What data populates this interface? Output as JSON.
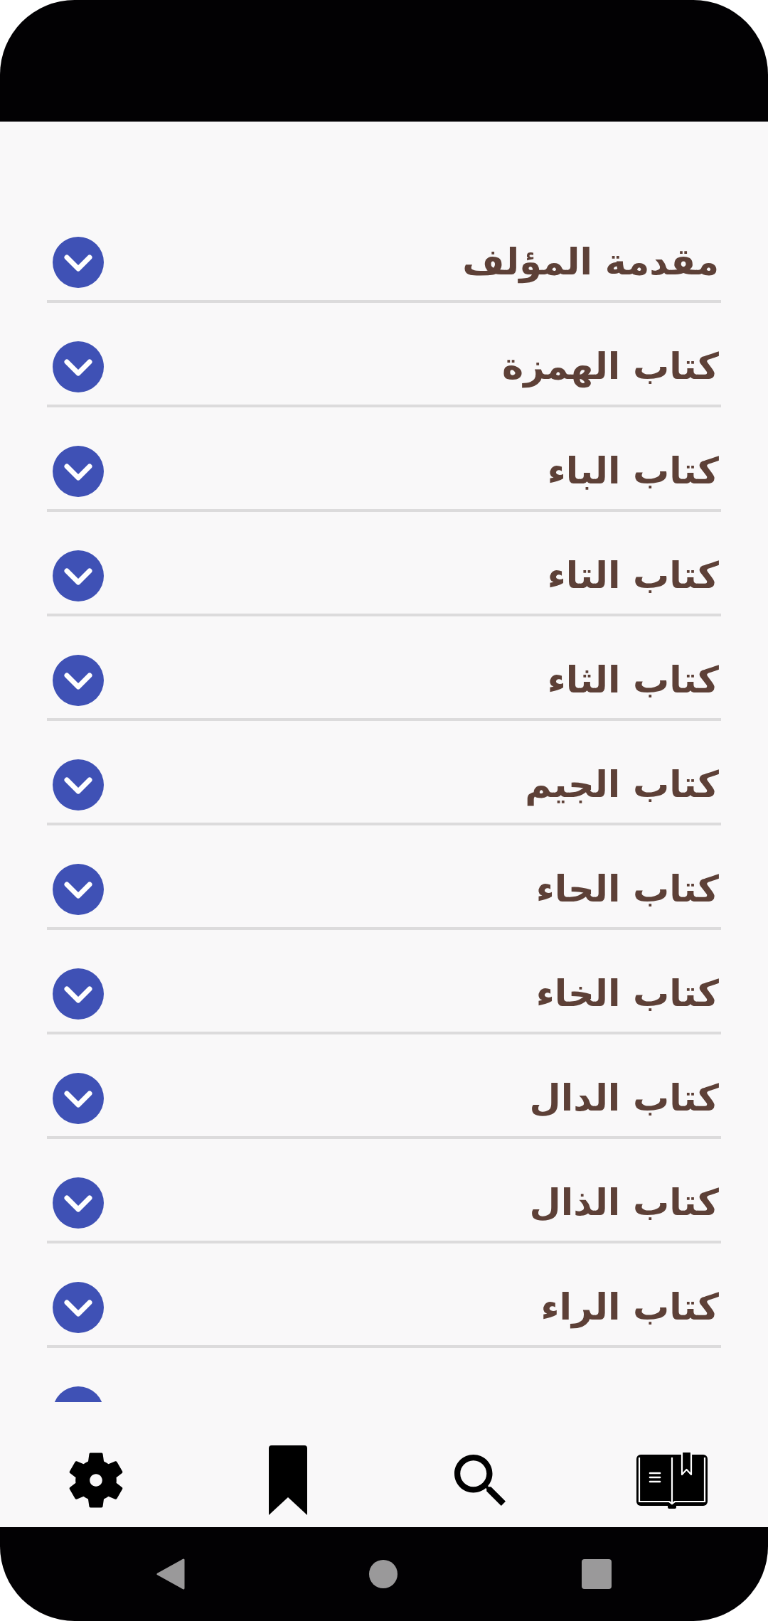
{
  "chapters": [
    {
      "title": "مقدمة المؤلف",
      "expanded": false
    },
    {
      "title": "كتاب الهمزة",
      "expanded": false
    },
    {
      "title": "كتاب الباء",
      "expanded": false
    },
    {
      "title": "كتاب التاء",
      "expanded": false
    },
    {
      "title": "كتاب الثاء",
      "expanded": false
    },
    {
      "title": "كتاب الجيم",
      "expanded": false
    },
    {
      "title": "كتاب الحاء",
      "expanded": false
    },
    {
      "title": "كتاب الخاء",
      "expanded": false
    },
    {
      "title": "كتاب الدال",
      "expanded": false
    },
    {
      "title": "كتاب الذال",
      "expanded": false
    },
    {
      "title": "كتاب الراء",
      "expanded": false
    }
  ]
}
